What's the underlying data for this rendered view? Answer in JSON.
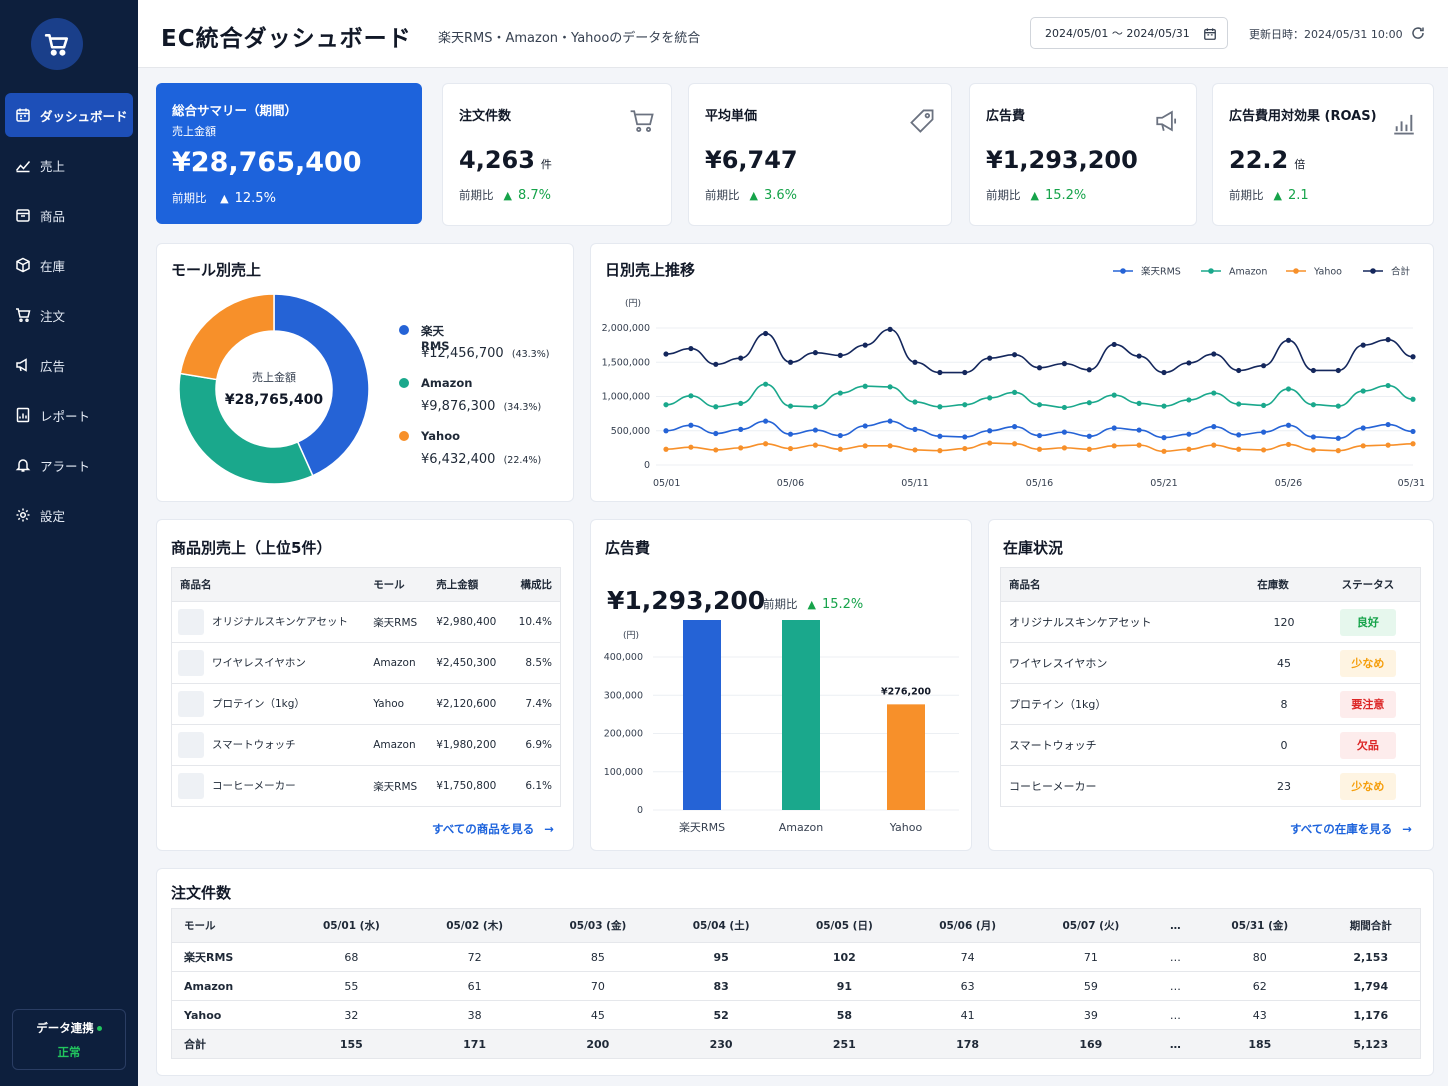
{
  "app": {
    "title": "EC統合ダッシュボード",
    "subtitle": "楽天RMS・Amazon・Yahooのデータを統合"
  },
  "header": {
    "date_range": "2024/05/01 〜 2024/05/31",
    "updated": "更新日時：2024/05/31 10:00"
  },
  "sidebar": {
    "items": [
      {
        "label": "ダッシュボード",
        "icon": "calendar-icon"
      },
      {
        "label": "売上",
        "icon": "trend-icon"
      },
      {
        "label": "商品",
        "icon": "box-icon"
      },
      {
        "label": "在庫",
        "icon": "cube-icon"
      },
      {
        "label": "注文",
        "icon": "cart-icon"
      },
      {
        "label": "広告",
        "icon": "megaphone-icon"
      },
      {
        "label": "レポート",
        "icon": "report-icon"
      },
      {
        "label": "アラート",
        "icon": "bell-icon"
      },
      {
        "label": "設定",
        "icon": "gear-icon"
      }
    ],
    "sync_label": "データ連携",
    "sync_status": "正常"
  },
  "kpis": {
    "summary": {
      "title": "総合サマリー（期間）",
      "label": "売上金額",
      "value": "¥28,765,400",
      "compare_label": "前期比",
      "change": "12.5%"
    },
    "orders": {
      "title": "注文件数",
      "value": "4,263",
      "unit": "件",
      "compare_label": "前期比",
      "change": "8.7%"
    },
    "avg_price": {
      "title": "平均単価",
      "value": "¥6,747",
      "compare_label": "前期比",
      "change": "3.6%"
    },
    "ad_cost": {
      "title": "広告費",
      "value": "¥1,293,200",
      "compare_label": "前期比",
      "change": "15.2%"
    },
    "roas": {
      "title": "広告費用対効果 (ROAS)",
      "value": "22.2",
      "unit": "倍",
      "compare_label": "前期比",
      "change": "2.1"
    }
  },
  "mall_sales": {
    "title": "モール別売上",
    "center_label": "売上金額",
    "center_value": "¥28,765,400",
    "items": [
      {
        "name": "楽天RMS",
        "value": "¥12,456,700",
        "pct": "(43.3%)"
      },
      {
        "name": "Amazon",
        "value": "¥9,876,300",
        "pct": "(34.3%)"
      },
      {
        "name": "Yahoo",
        "value": "¥6,432,400",
        "pct": "(22.4%)"
      }
    ]
  },
  "daily_sales": {
    "title": "日別売上推移",
    "unit": "(円)"
  },
  "product_sales": {
    "title": "商品別売上（上位5件）",
    "headers": [
      "商品名",
      "モール",
      "売上金額",
      "構成比"
    ],
    "rows": [
      {
        "name": "オリジナルスキンケアセット",
        "mall": "楽天RMS",
        "amount": "¥2,980,400",
        "ratio": "10.4%"
      },
      {
        "name": "ワイヤレスイヤホン",
        "mall": "Amazon",
        "amount": "¥2,450,300",
        "ratio": "8.5%"
      },
      {
        "name": "プロテイン（1kg）",
        "mall": "Yahoo",
        "amount": "¥2,120,600",
        "ratio": "7.4%"
      },
      {
        "name": "スマートウォッチ",
        "mall": "Amazon",
        "amount": "¥1,980,200",
        "ratio": "6.9%"
      },
      {
        "name": "コーヒーメーカー",
        "mall": "楽天RMS",
        "amount": "¥1,750,800",
        "ratio": "6.1%"
      }
    ],
    "link": "すべての商品を見る"
  },
  "ad_panel": {
    "title": "広告費",
    "value": "¥1,293,200",
    "compare_label": "前期比",
    "change": "15.2%",
    "unit": "(円)"
  },
  "inventory": {
    "title": "在庫状況",
    "headers": [
      "商品名",
      "在庫数",
      "ステータス"
    ],
    "rows": [
      {
        "name": "オリジナルスキンケアセット",
        "qty": "120",
        "status": "良好",
        "cls": "b-good"
      },
      {
        "name": "ワイヤレスイヤホン",
        "qty": "45",
        "status": "少なめ",
        "cls": "b-low"
      },
      {
        "name": "プロテイン（1kg）",
        "qty": "8",
        "status": "要注意",
        "cls": "b-warn"
      },
      {
        "name": "スマートウォッチ",
        "qty": "0",
        "status": "欠品",
        "cls": "b-warn"
      },
      {
        "name": "コーヒーメーカー",
        "qty": "23",
        "status": "少なめ",
        "cls": "b-low"
      }
    ],
    "link": "すべての在庫を見る"
  },
  "orders_table": {
    "title": "注文件数",
    "headers": [
      "モール",
      "05/01 (水)",
      "05/02 (木)",
      "05/03 (金)",
      "05/04 (土)",
      "05/05 (日)",
      "05/06 (月)",
      "05/07 (火)",
      "…",
      "05/31 (金)",
      "期間合計"
    ],
    "rows": [
      [
        "楽天RMS",
        "68",
        "72",
        "85",
        "95",
        "102",
        "74",
        "71",
        "…",
        "80",
        "2,153"
      ],
      [
        "Amazon",
        "55",
        "61",
        "70",
        "83",
        "91",
        "63",
        "59",
        "…",
        "62",
        "1,794"
      ],
      [
        "Yahoo",
        "32",
        "38",
        "45",
        "52",
        "58",
        "41",
        "39",
        "…",
        "43",
        "1,176"
      ],
      [
        "合計",
        "155",
        "171",
        "200",
        "230",
        "251",
        "178",
        "169",
        "…",
        "185",
        "5,123"
      ]
    ]
  },
  "colors": {
    "rakuten": "#2563d6",
    "amazon": "#1aa88c",
    "yahoo": "#f7902a",
    "total": "#14275c",
    "primary": "#1d63dc",
    "sidebar": "#0d1f3d"
  },
  "chart_data": [
    {
      "type": "pie",
      "categories": [
        "楽天RMS",
        "Amazon",
        "Yahoo"
      ],
      "values": [
        43.3,
        34.3,
        22.4
      ]
    },
    {
      "type": "line",
      "x": [
        "05/01",
        "05/02",
        "05/03",
        "05/04",
        "05/05",
        "05/06",
        "05/07",
        "05/08",
        "05/09",
        "05/10",
        "05/11",
        "05/12",
        "05/13",
        "05/14",
        "05/15",
        "05/16",
        "05/17",
        "05/18",
        "05/19",
        "05/20",
        "05/21",
        "05/22",
        "05/23",
        "05/24",
        "05/25",
        "05/26",
        "05/27",
        "05/28",
        "05/29",
        "05/30",
        "05/31"
      ],
      "xticks": [
        "05/01",
        "05/06",
        "05/11",
        "05/16",
        "05/21",
        "05/26",
        "05/31"
      ],
      "yticks": [
        "2,000,000",
        "1,500,000",
        "1,000,000",
        "500,000",
        "0"
      ],
      "ylim": [
        0,
        2000000
      ],
      "legend": "top-right",
      "series": [
        {
          "name": "楽天RMS",
          "values": [
            500000,
            580000,
            460000,
            520000,
            640000,
            450000,
            510000,
            430000,
            570000,
            640000,
            520000,
            420000,
            410000,
            500000,
            560000,
            430000,
            480000,
            420000,
            540000,
            510000,
            400000,
            450000,
            560000,
            440000,
            480000,
            580000,
            410000,
            390000,
            540000,
            590000,
            490000
          ]
        },
        {
          "name": "Amazon",
          "values": [
            880000,
            1010000,
            850000,
            900000,
            1180000,
            860000,
            850000,
            1050000,
            1150000,
            1140000,
            920000,
            850000,
            880000,
            980000,
            1060000,
            880000,
            840000,
            910000,
            1020000,
            900000,
            860000,
            950000,
            1050000,
            890000,
            870000,
            1110000,
            880000,
            860000,
            1080000,
            1160000,
            960000
          ]
        },
        {
          "name": "Yahoo",
          "values": [
            230000,
            260000,
            220000,
            250000,
            310000,
            240000,
            290000,
            230000,
            280000,
            280000,
            220000,
            210000,
            240000,
            320000,
            310000,
            230000,
            250000,
            230000,
            280000,
            290000,
            200000,
            230000,
            290000,
            230000,
            220000,
            300000,
            220000,
            210000,
            280000,
            290000,
            310000
          ]
        },
        {
          "name": "合計",
          "values": [
            1620000,
            1700000,
            1470000,
            1560000,
            1920000,
            1500000,
            1640000,
            1600000,
            1750000,
            1980000,
            1500000,
            1350000,
            1350000,
            1560000,
            1610000,
            1420000,
            1480000,
            1390000,
            1760000,
            1590000,
            1350000,
            1490000,
            1620000,
            1380000,
            1450000,
            1820000,
            1380000,
            1380000,
            1750000,
            1830000,
            1580000
          ]
        }
      ]
    },
    {
      "type": "bar",
      "categories": [
        "楽天RMS",
        "Amazon",
        "Yahoo"
      ],
      "values": [
        504300,
        512700,
        276200
      ],
      "labels": [
        "¥504,300",
        "¥512,700",
        "¥276,200"
      ],
      "yticks": [
        "400,000",
        "300,000",
        "200,000",
        "100,000",
        "0"
      ],
      "ylim": [
        0,
        400000
      ]
    }
  ]
}
